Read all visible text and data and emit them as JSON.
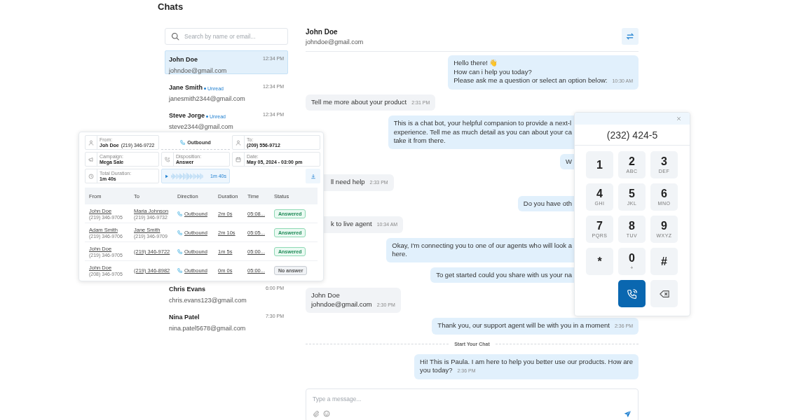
{
  "page_title": "Chats",
  "search": {
    "placeholder": "Search by name or email..."
  },
  "contacts": [
    {
      "name": "John Doe",
      "email": "johndoe@gmail.com",
      "time": "12:34 PM",
      "selected": true
    },
    {
      "name": "Jane Smith",
      "badge": "Unread",
      "email": "janesmith2344@gmail.com",
      "time": "12:34 PM",
      "selected": false
    },
    {
      "name": "Steve Jorge",
      "badge": "Unread",
      "email": "steve2344@gmail.com",
      "time": "12:34 PM",
      "selected": false
    },
    {
      "name": "Chris Evans",
      "email": "chris.evans123@gmail.com",
      "time": "6:00 PM",
      "selected": false
    },
    {
      "name": "Nina Patel",
      "email": "nina.patel5678@gmail.com",
      "time": "7:30 PM",
      "selected": false
    }
  ],
  "conversation": {
    "name": "John Doe",
    "email": "johndoe@gmail.com"
  },
  "messages": [
    {
      "kind": "out",
      "text": "Hello there! 👋\nHow can i help you today?\nPlease ask me a question or select an option below:",
      "time": "10:30 AM",
      "covered": false
    },
    {
      "kind": "in",
      "text": "Tell me more about your product",
      "time": "2:31 PM",
      "covered": false
    },
    {
      "kind": "out",
      "text": "This is a chat bot, your helpful companion to provide a next-l\nexperience. Tell me as much detail as you can about your ca\ntake it from there.",
      "covered": true
    },
    {
      "kind": "out",
      "text": "W",
      "covered": true
    },
    {
      "kind": "in",
      "text": "ll need help",
      "time": "2:33 PM",
      "covered": true
    },
    {
      "kind": "out",
      "text": "Do you have oth",
      "covered": true
    },
    {
      "kind": "in",
      "text": "k to live agent",
      "time": "10:34 AM",
      "covered": true
    },
    {
      "kind": "out",
      "text": "Okay, I'm connecting you to one of our agents who will look a\nhere.",
      "covered": true
    },
    {
      "kind": "out",
      "text": "To get started could you share with us your na",
      "covered": true
    },
    {
      "kind": "in",
      "text": "John Doe\njohndoe@gmail.com",
      "time": "2:30 PM",
      "covered": false
    },
    {
      "kind": "out",
      "text": "Thank you, our support agent will be with you in a moment",
      "time": "2:36 PM",
      "covered": false
    },
    {
      "kind": "divider",
      "text": "Start Your Chat"
    },
    {
      "kind": "out",
      "text": "Hi! This is Paula. I am here to help you better use our products. How are\nyou today?",
      "time": "2:36 PM",
      "covered": false
    }
  ],
  "composer": {
    "placeholder": "Type a message..."
  },
  "call_card": {
    "from": {
      "label": "From:",
      "name": "Joh Doe",
      "phone": "(219) 346-9722"
    },
    "direction": "Outbound",
    "to": {
      "label": "To:",
      "value": "(209) 556-9712"
    },
    "campaign": {
      "label": "Campaign:",
      "value": "Mega Sale"
    },
    "disposition": {
      "label": "Disposition:",
      "value": "Answer"
    },
    "date": {
      "label": "Date:",
      "value": "May 05, 2024 - 03:00 pm"
    },
    "total_duration": {
      "label": "Total Duration:",
      "value": "1m 40s"
    },
    "recording": {
      "length": "1m 40s"
    },
    "table": {
      "columns": [
        "From",
        "To",
        "Direction",
        "Duration",
        "Time",
        "Status"
      ],
      "rows": [
        {
          "from_name": "John Doe",
          "from_phone": "(219) 346-9705",
          "to_name": "Maria Johnson",
          "to_phone": "(219) 346-9732",
          "direction": "Outbound",
          "duration": "2m 0s",
          "time": "05:08...",
          "status": "Answered",
          "answered": true
        },
        {
          "from_name": "Adam Smith",
          "from_phone": "(219) 346-9706",
          "to_name": "Jane Smith",
          "to_phone": "(219) 346-9709",
          "direction": "Outbound",
          "duration": "2m 10s",
          "time": "05:05...",
          "status": "Answered",
          "answered": true
        },
        {
          "from_name": "John Doe",
          "from_phone": "(219) 346-9705",
          "to_phone": "(219) 346-9722",
          "direction": "Outbound",
          "duration": "1m 5s",
          "time": "05:00...",
          "status": "Answered",
          "answered": true
        },
        {
          "from_name": "John Doe",
          "from_phone": "(208) 346-9705",
          "to_phone": "(219) 346-8982",
          "direction": "Outbound",
          "duration": "0m 0s",
          "time": "05:00...",
          "status": "No answer",
          "answered": false
        }
      ]
    }
  },
  "dialer": {
    "number": "(232) 424-5",
    "keys": [
      {
        "digit": "1"
      },
      {
        "digit": "2",
        "letters": "ABC"
      },
      {
        "digit": "3",
        "letters": "DEF"
      },
      {
        "digit": "4",
        "letters": "GHI"
      },
      {
        "digit": "5",
        "letters": "JKL"
      },
      {
        "digit": "6",
        "letters": "MNO"
      },
      {
        "digit": "7",
        "letters": "PQRS"
      },
      {
        "digit": "8",
        "letters": "TUV"
      },
      {
        "digit": "9",
        "letters": "WXYZ"
      },
      {
        "digit": "*"
      },
      {
        "digit": "0",
        "letters": "+"
      },
      {
        "digit": "#"
      }
    ]
  }
}
